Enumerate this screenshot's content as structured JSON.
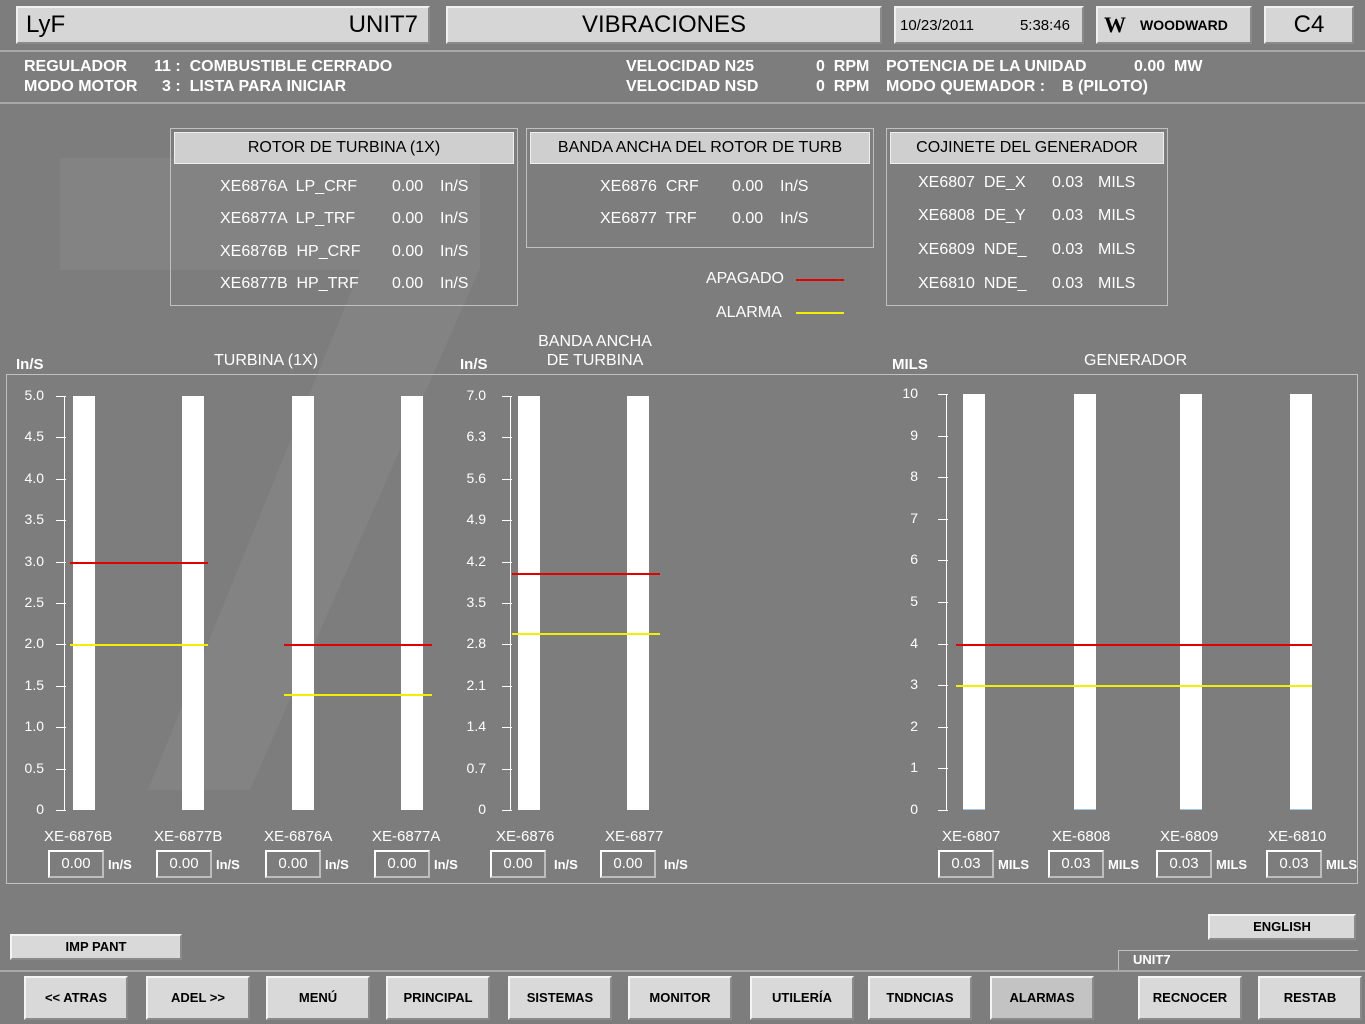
{
  "header": {
    "site": "LyF",
    "unit": "UNIT7",
    "screen_title": "VIBRACIONES",
    "date": "10/23/2011",
    "time": "5:38:46",
    "brand": "WOODWARD",
    "code": "C4"
  },
  "status": {
    "regulador_label": "REGULADOR",
    "regulador_value": "11 :  COMBUSTIBLE CERRADO",
    "modo_motor_label": "MODO MOTOR",
    "modo_motor_value": "3 :  LISTA PARA INICIAR",
    "vel_n25_label": "VELOCIDAD N25",
    "vel_n25_value": "0  RPM",
    "vel_nsd_label": "VELOCIDAD NSD",
    "vel_nsd_value": "0  RPM",
    "potencia_label": "POTENCIA DE LA UNIDAD",
    "potencia_value": "0.00  MW",
    "quemador_label": "MODO QUEMADOR :",
    "quemador_value": "B (PILOTO)"
  },
  "tables": {
    "rotor": {
      "title": "ROTOR DE TURBINA (1X)",
      "rows": [
        {
          "tag": "XE6876A  LP_CRF",
          "value": "0.00",
          "unit": "In/S"
        },
        {
          "tag": "XE6877A  LP_TRF",
          "value": "0.00",
          "unit": "In/S"
        },
        {
          "tag": "XE6876B  HP_CRF",
          "value": "0.00",
          "unit": "In/S"
        },
        {
          "tag": "XE6877B  HP_TRF",
          "value": "0.00",
          "unit": "In/S"
        }
      ]
    },
    "banda": {
      "title": "BANDA ANCHA DEL ROTOR DE TURB",
      "rows": [
        {
          "tag": "XE6876  CRF",
          "value": "0.00",
          "unit": "In/S"
        },
        {
          "tag": "XE6877  TRF",
          "value": "0.00",
          "unit": "In/S"
        }
      ]
    },
    "cojinete": {
      "title": "COJINETE DEL GENERADOR",
      "rows": [
        {
          "tag": "XE6807  DE_X",
          "value": "0.03",
          "unit": "MILS"
        },
        {
          "tag": "XE6808  DE_Y",
          "value": "0.03",
          "unit": "MILS"
        },
        {
          "tag": "XE6809  NDE_",
          "value": "0.03",
          "unit": "MILS"
        },
        {
          "tag": "XE6810  NDE_",
          "value": "0.03",
          "unit": "MILS"
        }
      ]
    }
  },
  "legend": {
    "apagado": "APAGADO",
    "alarma": "ALARMA",
    "apagado_color": "#e00000",
    "alarma_color": "#f0f000"
  },
  "chart_data": [
    {
      "type": "bar",
      "title": "TURBINA (1X)",
      "ylabel": "In/S",
      "ylim": [
        0,
        5
      ],
      "yticks": [
        "5.0",
        "4.5",
        "4.0",
        "3.5",
        "3.0",
        "2.5",
        "2.0",
        "1.5",
        "1.0",
        "0.5",
        "0"
      ],
      "categories": [
        "XE-6876B",
        "XE-6877B",
        "XE-6876A",
        "XE-6877A"
      ],
      "values": [
        0.0,
        0.0,
        0.0,
        0.0
      ],
      "value_labels": [
        "0.00",
        "0.00",
        "0.00",
        "0.00"
      ],
      "unit": "In/S",
      "limits": [
        {
          "bars": [
            0,
            1
          ],
          "apagado": 3.0,
          "alarma": 2.0
        },
        {
          "bars": [
            2,
            3
          ],
          "apagado": 2.0,
          "alarma": 1.4
        }
      ]
    },
    {
      "type": "bar",
      "title": "BANDA ANCHA DE TURBINA",
      "ylabel": "In/S",
      "ylim": [
        0,
        7
      ],
      "yticks": [
        "7.0",
        "6.3",
        "5.6",
        "4.9",
        "4.2",
        "3.5",
        "2.8",
        "2.1",
        "1.4",
        "0.7",
        "0"
      ],
      "categories": [
        "XE-6876",
        "XE-6877"
      ],
      "values": [
        0.0,
        0.0
      ],
      "value_labels": [
        "0.00",
        "0.00"
      ],
      "unit": "In/S",
      "limits": [
        {
          "bars": [
            0,
            1
          ],
          "apagado": 4.0,
          "alarma": 3.0
        }
      ]
    },
    {
      "type": "bar",
      "title": "GENERADOR",
      "ylabel": "MILS",
      "ylim": [
        0,
        10
      ],
      "yticks": [
        "10",
        "9",
        "8",
        "7",
        "6",
        "5",
        "4",
        "3",
        "2",
        "1",
        "0"
      ],
      "categories": [
        "XE-6807",
        "XE-6808",
        "XE-6809",
        "XE-6810"
      ],
      "values": [
        0.03,
        0.03,
        0.03,
        0.03
      ],
      "value_labels": [
        "0.03",
        "0.03",
        "0.03",
        "0.03"
      ],
      "unit": "MILS",
      "limits": [
        {
          "bars": [
            0,
            1,
            2,
            3
          ],
          "apagado": 4.0,
          "alarma": 3.0
        }
      ]
    }
  ],
  "buttons": {
    "imp_pant": "IMP PANT",
    "english": "ENGLISH",
    "unit_label": "UNIT7",
    "nav": [
      "<< ATRAS",
      "ADEL >>",
      "MENÚ",
      "PRINCIPAL",
      "SISTEMAS",
      "MONITOR",
      "UTILERÍA",
      "TNDNCIAS",
      "ALARMAS"
    ],
    "recnocer": "RECNOCER",
    "restab": "RESTAB"
  }
}
